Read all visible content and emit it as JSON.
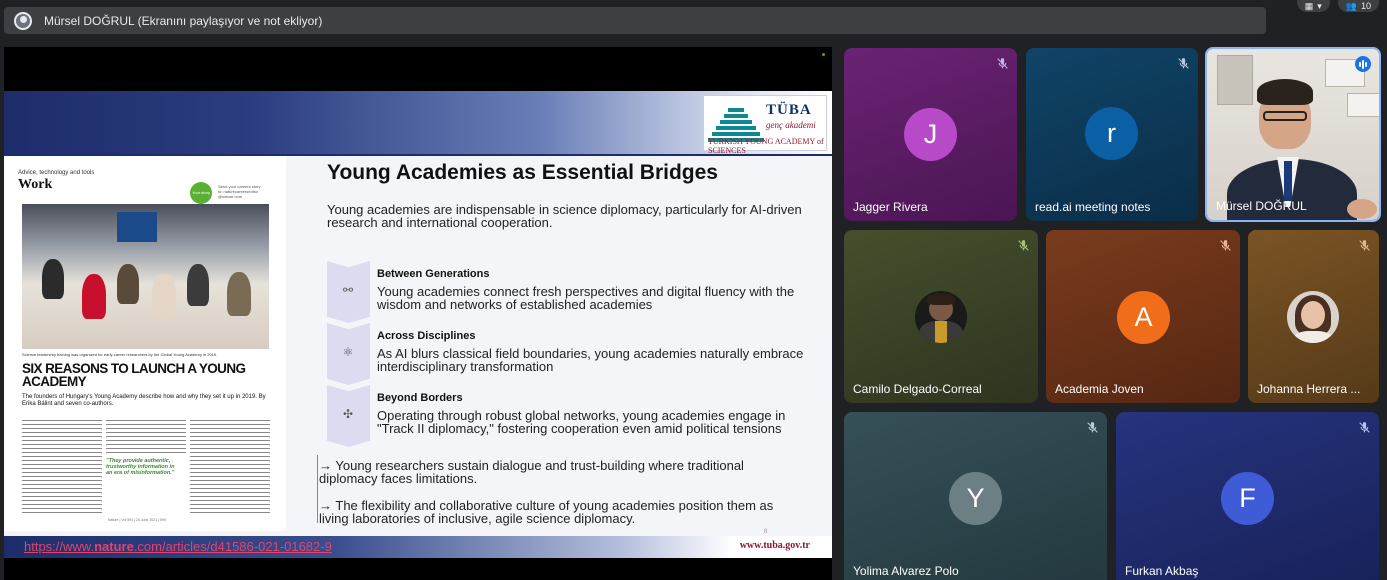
{
  "app": {
    "accent": "#1a73e8",
    "background": "#202124"
  },
  "topbar": {
    "presenter_text": "Mürsel DOĞRUL (Ekranını paylaşıyor ve not ekliyor)",
    "participant_count": "10"
  },
  "slide": {
    "logo": {
      "name": "TÜBA",
      "sub": "genç akademi",
      "tagline": "TURKISH YOUNG ACADEMY of SCIENCES"
    },
    "title": "Young Academies as Essential Bridges",
    "intro": "Young academies are indispensable in science diplomacy, particularly for AI-driven research and international cooperation.",
    "items": [
      {
        "title": "Between Generations",
        "desc": "Young academies connect fresh perspectives and digital fluency with the wisdom and networks of established academies",
        "icon": "share-nodes-icon"
      },
      {
        "title": "Across Disciplines",
        "desc": "As AI blurs classical field boundaries, young academies naturally embrace interdisciplinary transformation",
        "icon": "molecule-icon"
      },
      {
        "title": "Beyond Borders",
        "desc": "Operating through robust global networks, young academies engage in \"Track II diplomacy,\" fostering cooperation even amid political tensions",
        "icon": "network-icon"
      }
    ],
    "arrows": [
      "→ Young researchers sustain dialogue and trust-building where traditional diplomacy faces limitations.",
      "→ The flexibility and collaborative culture of young academies position them as living laboratories of inclusive, agile science diplomacy."
    ],
    "page_number": "8",
    "link_prefix": "https://www.",
    "link_bold": "nature",
    "link_suffix": ".com/articles/d41586-021-01682-9",
    "footer_url": "www.tuba.gov.tr",
    "magazine": {
      "tag": "Advice, technology and tools",
      "section": "Work",
      "badge": "Your story",
      "send": "Send your careers story to: naturecareerseditor @nature.com",
      "caption": "Science leadership training was organized for early-career researchers by the Global Young Academy in 2019.",
      "headline": "SIX REASONS TO LAUNCH A YOUNG ACADEMY",
      "deck": "The founders of Hungary's Young Academy describe how and why they set it up in 2019. By Erika Bálint and seven co-authors.",
      "pull_quote": "\"They provide authentic, trustworthy information in an era of misinformation.\"",
      "footer": "Nature | Vol 594 | 24 June 2021 | 599"
    }
  },
  "participants": [
    {
      "name": "Jagger Rivera",
      "initial": "J",
      "avatar_color": "#b84ac9",
      "tile_bg": "#5b1d63",
      "muted": true
    },
    {
      "name": "read.ai meeting notes",
      "initial": "r",
      "avatar_color": "#0b5fa5",
      "tile_bg": "#0e3a5a",
      "muted": true
    },
    {
      "name": "Mürsel DOĞRUL",
      "initial": "",
      "avatar_color": "",
      "tile_bg": "#d8d4cf",
      "muted": false,
      "speaking": true
    },
    {
      "name": "Camilo Delgado-Correal",
      "initial": "",
      "avatar_color": "",
      "tile_bg": "#3a4227",
      "muted": true
    },
    {
      "name": "Academia Joven",
      "initial": "A",
      "avatar_color": "#f06d1a",
      "tile_bg": "#6b3318",
      "muted": true
    },
    {
      "name": "Johanna Herrera ...",
      "initial": "",
      "avatar_color": "",
      "tile_bg": "#6b4820",
      "muted": true
    },
    {
      "name": "Yolima Alvarez Polo",
      "initial": "Y",
      "avatar_color": "#6c7f84",
      "tile_bg": "#2f4248",
      "muted": true
    },
    {
      "name": "Furkan Akbaş",
      "initial": "F",
      "avatar_color": "#3f5bd6",
      "tile_bg": "#1f2a6b",
      "muted": true
    }
  ]
}
